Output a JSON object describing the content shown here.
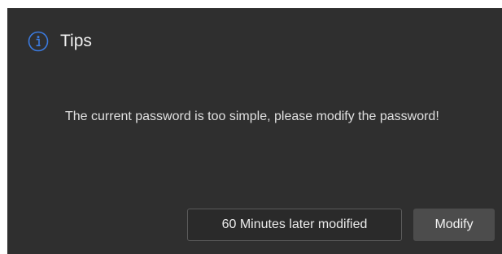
{
  "dialog": {
    "icon": "info-circle-icon",
    "accent_color": "#3b7be0",
    "title": "Tips",
    "message": "The current password is too simple, please modify the password!",
    "buttons": {
      "later_label": "60 Minutes later modified",
      "modify_label": "Modify"
    }
  }
}
